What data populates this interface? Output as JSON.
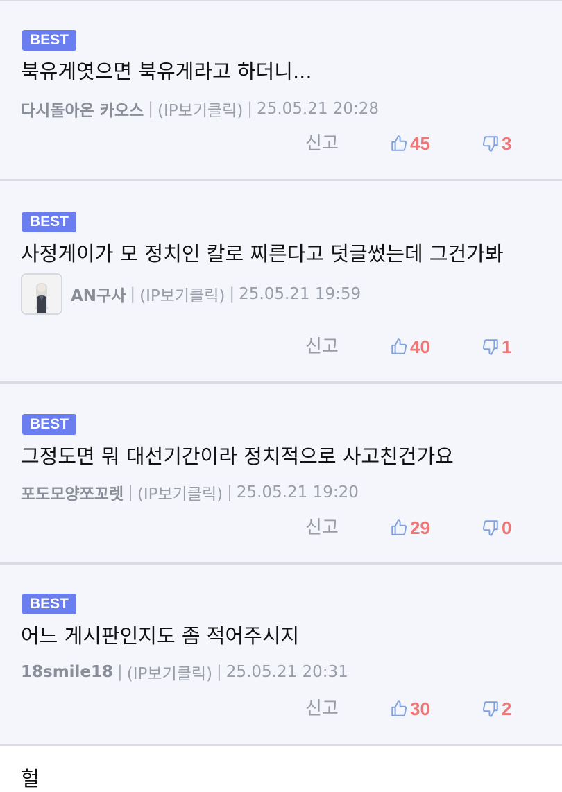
{
  "comments": [
    {
      "badge": "BEST",
      "text": "북유게엿으면 북유게라고 하더니...",
      "author": "다시돌아온 카오스",
      "ip": "(IP보기클릭)",
      "date": "25.05.21 20:28",
      "report": "신고",
      "likes": "45",
      "dislikes": "3"
    },
    {
      "badge": "BEST",
      "text": "사정게이가 모 정치인 칼로 찌른다고 덧글썼는데 그건가봐",
      "author": "AN구사",
      "ip": "(IP보기클릭)",
      "date": "25.05.21 19:59",
      "report": "신고",
      "likes": "40",
      "dislikes": "1"
    },
    {
      "badge": "BEST",
      "text": "그정도면 뭐 대선기간이라 정치적으로 사고친건가요",
      "author": "포도모양쪼꼬렛",
      "ip": "(IP보기클릭)",
      "date": "25.05.21 19:20",
      "report": "신고",
      "likes": "29",
      "dislikes": "0"
    },
    {
      "badge": "BEST",
      "text": "어느 게시판인지도 좀 적어주시지",
      "author": "18smile18",
      "ip": "(IP보기클릭)",
      "date": "25.05.21 20:31",
      "report": "신고",
      "likes": "30",
      "dislikes": "2"
    }
  ],
  "next_comment": {
    "text": "헐"
  },
  "colors": {
    "badge": "#6a7ef0",
    "count": "#f07676",
    "thumb": "#7fa1dd",
    "card_bg": "#f4f6fc"
  },
  "icons": {
    "like": "thumbs-up-icon",
    "dislike": "thumbs-down-icon"
  }
}
